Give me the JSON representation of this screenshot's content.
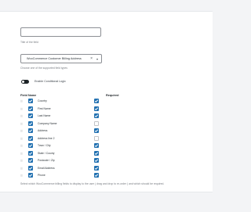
{
  "title_field": {
    "value": "",
    "hint": "Title of the field"
  },
  "field_type": {
    "selected": "WooCommerce Customer Billing Address",
    "clear_symbol": "×",
    "hint": "Choose one of the supported field types"
  },
  "conditional_logic": {
    "label": "Enable Conditional Logic",
    "enabled": false
  },
  "table": {
    "header_field_name": "Field Name",
    "header_required": "Required",
    "rows": [
      {
        "label": "Country",
        "enabled": true,
        "required": true
      },
      {
        "label": "First Name",
        "enabled": true,
        "required": true
      },
      {
        "label": "Last Name",
        "enabled": true,
        "required": true
      },
      {
        "label": "Company Name",
        "enabled": true,
        "required": false
      },
      {
        "label": "Address",
        "enabled": true,
        "required": true
      },
      {
        "label": "Address line 2",
        "enabled": true,
        "required": false
      },
      {
        "label": "Town / City",
        "enabled": true,
        "required": true
      },
      {
        "label": "State / County",
        "enabled": true,
        "required": true
      },
      {
        "label": "Postcode / Zip",
        "enabled": true,
        "required": true
      },
      {
        "label": "Email Address",
        "enabled": true,
        "required": true
      },
      {
        "label": "Phone",
        "enabled": true,
        "required": true
      }
    ],
    "footer_hint": "Select which WooCommerce billing fields to display to the user ( drag and drop to re-order ) and which should be required."
  },
  "colors": {
    "accent": "#2271b1",
    "toggle": "#1d2327"
  },
  "icons": {
    "drag_handle": "drag-handle-icon",
    "select_arrow": "chevron-down-icon",
    "clear": "clear-icon"
  }
}
